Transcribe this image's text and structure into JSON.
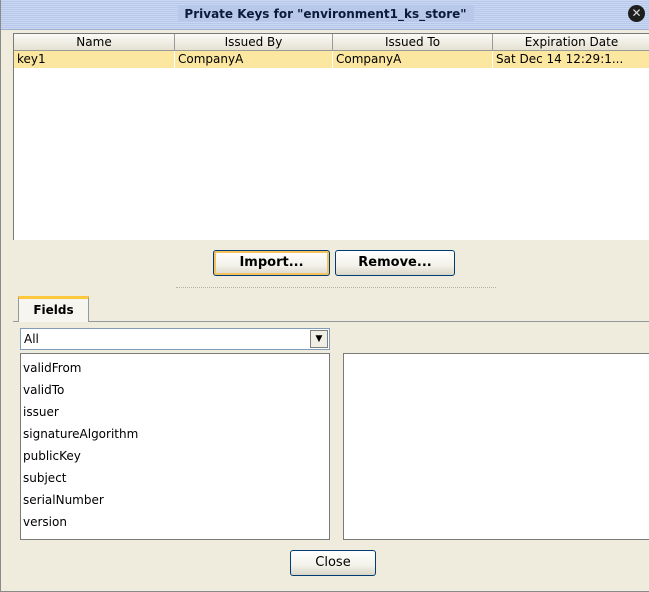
{
  "window": {
    "title": "Private Keys for \"environment1_ks_store\"",
    "close_glyph": "✕"
  },
  "table": {
    "columns": [
      "Name",
      "Issued By",
      "Issued To",
      "Expiration Date"
    ],
    "rows": [
      [
        "key1",
        "CompanyA",
        "CompanyA",
        "Sat Dec 14 12:29:1..."
      ]
    ],
    "selected_row": 0
  },
  "buttons": {
    "import": "Import...",
    "remove": "Remove...",
    "close": "Close"
  },
  "tabs": {
    "fields": "Fields"
  },
  "filter": {
    "selected": "All",
    "arrow_glyph": "▼"
  },
  "fields_list": [
    "validFrom",
    "validTo",
    "issuer",
    "signatureAlgorithm",
    "publicKey",
    "subject",
    "serialNumber",
    "version"
  ],
  "colors": {
    "title_bar": "#b7c8ea",
    "selected_row": "#fbe7a0",
    "default_button_ring": "#f6c25e",
    "dialog_background": "#efecde",
    "tab_highlight": "#ffc83c"
  }
}
